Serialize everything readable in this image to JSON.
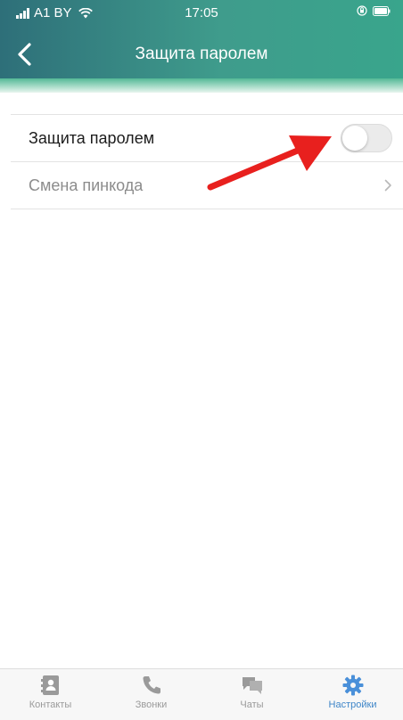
{
  "status_bar": {
    "carrier": "A1 BY",
    "time": "17:05"
  },
  "nav": {
    "title": "Защита паролем",
    "back_icon": "chevron-left-icon"
  },
  "settings": {
    "items": [
      {
        "label": "Защита паролем",
        "control": "toggle",
        "enabled": false
      },
      {
        "label": "Смена пинкода",
        "control": "chevron"
      }
    ]
  },
  "tabs": [
    {
      "label": "Контакты",
      "icon": "contacts-icon",
      "active": false
    },
    {
      "label": "Звонки",
      "icon": "phone-icon",
      "active": false
    },
    {
      "label": "Чаты",
      "icon": "chats-icon",
      "active": false
    },
    {
      "label": "Настройки",
      "icon": "gear-icon",
      "active": true
    }
  ],
  "colors": {
    "header_start": "#2e6f79",
    "header_end": "#39a58c",
    "tab_inactive": "#9a9a9a",
    "tab_active": "#3f86c8",
    "annotation_arrow": "#e8201e"
  }
}
